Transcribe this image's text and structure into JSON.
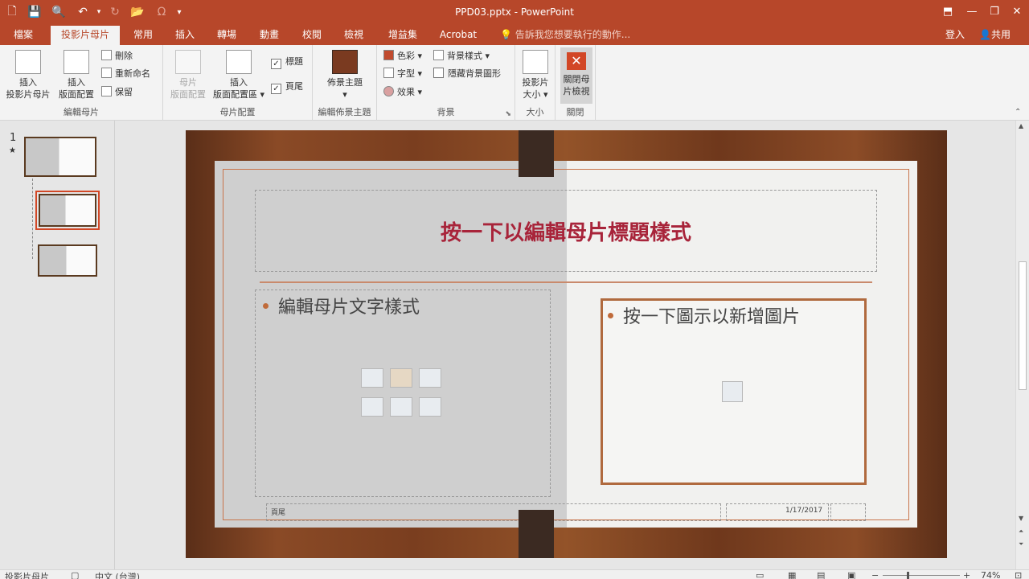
{
  "window": {
    "title": "PPD03.pptx - PowerPoint"
  },
  "tabs": [
    "檔案",
    "投影片母片",
    "常用",
    "插入",
    "轉場",
    "動畫",
    "校閱",
    "檢視",
    "增益集",
    "Acrobat"
  ],
  "tell_me": "告訴我您想要執行的動作...",
  "account": {
    "login": "登入",
    "share": "共用"
  },
  "ribbon": {
    "edit_master": {
      "label": "編輯母片",
      "insert_slide_master": [
        "插入",
        "投影片母片"
      ],
      "insert_layout": [
        "插入",
        "版面配置"
      ],
      "delete": "刪除",
      "rename": "重新命名",
      "preserve": "保留"
    },
    "master_layout": {
      "label": "母片配置",
      "master_layout_btn": [
        "母片",
        "版面配置"
      ],
      "insert_placeholder": [
        "插入",
        "版面配置區"
      ],
      "title_check": "標題",
      "footer_check": "頁尾"
    },
    "edit_theme": {
      "label": "編輯佈景主題",
      "themes": "佈景主題"
    },
    "background": {
      "label": "背景",
      "colors": "色彩",
      "fonts": "字型",
      "effects": "效果",
      "bg_styles": "背景樣式",
      "hide_bg": "隱藏背景圖形"
    },
    "size": {
      "label": "大小",
      "slide_size": [
        "投影片",
        "大小"
      ]
    },
    "close": {
      "label": "關閉",
      "close_master": [
        "關閉母",
        "片檢視"
      ]
    }
  },
  "thumbnails": {
    "number": "1",
    "star": "★"
  },
  "slide": {
    "title": "按一下以編輯母片標題樣式",
    "left_bullet": "編輯母片文字樣式",
    "right_bullet": "按一下圖示以新增圖片",
    "footer": "頁尾",
    "date": "1/17/2017"
  },
  "status": {
    "view": "投影片母片",
    "language": "中文 (台灣)",
    "zoom": "74%"
  },
  "colors": {
    "accent": "#b7472a",
    "title_red": "#a8243a"
  }
}
